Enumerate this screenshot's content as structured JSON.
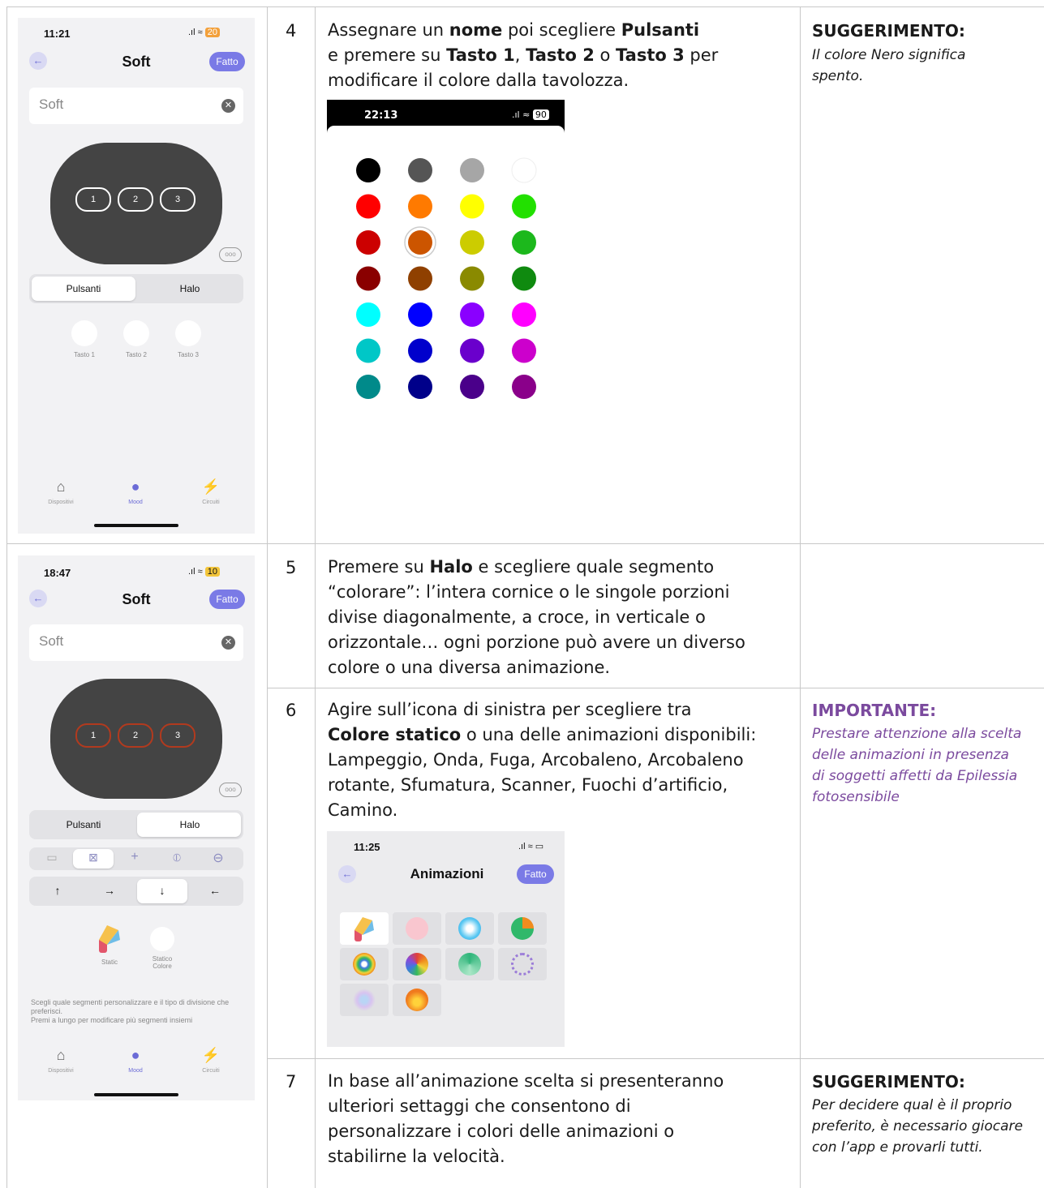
{
  "rows": [
    {
      "number": "4",
      "instruction_html": "Assegnare un <b>nome</b> poi scegliere <b>Pulsanti</b><br>e premere su <b>Tasto 1</b>, <b>Tasto 2</b> o <b>Tasto 3</b> per<br>modificare il colore dalla tavolozza.",
      "tip_title": "SUGGERIMENTO:",
      "tip_text": "Il colore Nero significa spento."
    },
    {
      "number": "5",
      "instruction_html": "Premere su <b>Halo</b> e scegliere quale segmento<br>“colorare”: l’intera cornice o le singole porzioni<br>divise diagonalmente, a croce, in verticale o<br>orizzontale… ogni porzione può avere un diverso<br>colore o una diversa animazione."
    },
    {
      "number": "6",
      "instruction_html": "Agire sull’icona di sinistra per scegliere tra<br><b>Colore statico</b> o una delle animazioni disponibili:<br>Lampeggio, Onda, Fuga, Arcobaleno, Arcobaleno<br>rotante, Sfumatura, Scanner, Fuochi d’artificio,<br>Camino.",
      "tip_title": "IMPORTANTE:",
      "tip_text": "Prestare attenzione alla scelta delle animazioni in presenza di soggetti affetti da Epilessia fotosensibile"
    },
    {
      "number": "7",
      "instruction_html": "In base all’animazione scelta si presenteranno<br>ulteriori settaggi che consentono di<br>personalizzare i colori delle animazioni o<br>stabilirne la velocità.",
      "tip_title": "SUGGERIMENTO:",
      "tip_text": "Per decidere qual è il proprio preferito, è necessario giocare con l’app e provarli tutti."
    }
  ],
  "phone1": {
    "time": "11:21",
    "battery": "20",
    "title": "Soft",
    "done": "Fatto",
    "field": "Soft",
    "buttons": [
      "1",
      "2",
      "3"
    ],
    "more": "ooo",
    "seg_left": "Pulsanti",
    "seg_right": "Halo",
    "keys": [
      "Tasto 1",
      "Tasto 2",
      "Tasto 3"
    ],
    "tabs": [
      "Dispositivi",
      "Mood",
      "Circuiti"
    ]
  },
  "phone2": {
    "time": "18:47",
    "battery": "10",
    "title": "Soft",
    "done": "Fatto",
    "field": "Soft",
    "buttons": [
      "1",
      "2",
      "3"
    ],
    "more": "ooo",
    "seg_left": "Pulsanti",
    "seg_right": "Halo",
    "directions": [
      "↑",
      "→",
      "↓",
      "←"
    ],
    "static_label": "Static",
    "static_color_label": "Statico\nColore",
    "help_text": "Scegli quale segmenti personalizzare e il tipo di divisione che preferisci.\nPremi a lungo per modificare più segmenti insiemi",
    "tabs": [
      "Dispositivi",
      "Mood",
      "Circuiti"
    ]
  },
  "palette": {
    "time": "22:13",
    "battery": "90",
    "colors": [
      [
        "#000000",
        "#555555",
        "#a6a6a6",
        "#ffffff"
      ],
      [
        "#ff0000",
        "#ff7a00",
        "#ffff00",
        "#22e000"
      ],
      [
        "#cc0000",
        "#cc5500",
        "#cccc00",
        "#1cb81c"
      ],
      [
        "#8a0000",
        "#8f4000",
        "#8a8a00",
        "#0f8a0f"
      ],
      [
        "#00ffff",
        "#0000ff",
        "#8a00ff",
        "#ff00ff"
      ],
      [
        "#00c7c7",
        "#0000cc",
        "#6a00cc",
        "#cc00cc"
      ],
      [
        "#008a8a",
        "#00008a",
        "#4a008a",
        "#8a008a"
      ]
    ]
  },
  "animations": {
    "time": "11:25",
    "title": "Animazioni",
    "done": "Fatto"
  }
}
